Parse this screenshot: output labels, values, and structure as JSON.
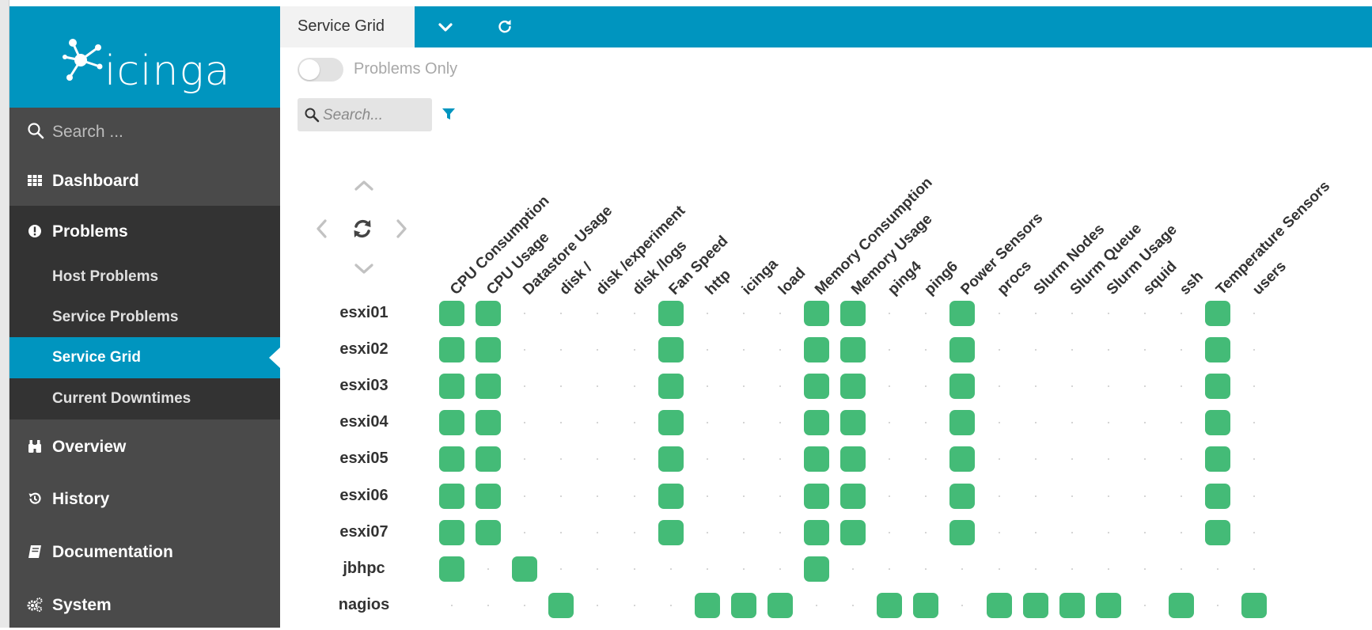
{
  "app": {
    "logo_text": "icinga"
  },
  "sidebar": {
    "search_placeholder": "Search ...",
    "items": [
      {
        "label": "Dashboard"
      },
      {
        "label": "Problems"
      },
      {
        "label": "Overview"
      },
      {
        "label": "History"
      },
      {
        "label": "Documentation"
      },
      {
        "label": "System"
      }
    ],
    "problems_sub": [
      {
        "label": "Host Problems"
      },
      {
        "label": "Service Problems"
      },
      {
        "label": "Service Grid",
        "active": true
      },
      {
        "label": "Current Downtimes"
      }
    ]
  },
  "tab": {
    "title": "Service Grid"
  },
  "toggle": {
    "label": "Problems Only",
    "on": false
  },
  "grid_search": {
    "placeholder": "Search..."
  },
  "colors": {
    "brand": "#0095bf",
    "ok": "#44bb77",
    "sidebar": "#4a4a4a",
    "sidebar_dark": "#333333"
  },
  "grid": {
    "services": [
      "CPU Consumption",
      "CPU Usage",
      "Datastore Usage",
      "disk /",
      "disk /experiment",
      "disk /logs",
      "Fan Speed",
      "http",
      "icinga",
      "load",
      "Memory Consumption",
      "Memory Usage",
      "ping4",
      "ping6",
      "Power Sensors",
      "procs",
      "Slurm Nodes",
      "Slurm Queue",
      "Slurm Usage",
      "squid",
      "ssh",
      "Temperature Sensors",
      "users"
    ],
    "hosts": [
      {
        "name": "esxi01",
        "ok": [
          0,
          1,
          6,
          10,
          11,
          14,
          21
        ]
      },
      {
        "name": "esxi02",
        "ok": [
          0,
          1,
          6,
          10,
          11,
          14,
          21
        ]
      },
      {
        "name": "esxi03",
        "ok": [
          0,
          1,
          6,
          10,
          11,
          14,
          21
        ]
      },
      {
        "name": "esxi04",
        "ok": [
          0,
          1,
          6,
          10,
          11,
          14,
          21
        ]
      },
      {
        "name": "esxi05",
        "ok": [
          0,
          1,
          6,
          10,
          11,
          14,
          21
        ]
      },
      {
        "name": "esxi06",
        "ok": [
          0,
          1,
          6,
          10,
          11,
          14,
          21
        ]
      },
      {
        "name": "esxi07",
        "ok": [
          0,
          1,
          6,
          10,
          11,
          14,
          21
        ]
      },
      {
        "name": "jbhpc",
        "ok": [
          0,
          2,
          10
        ]
      },
      {
        "name": "nagios",
        "ok": [
          3,
          7,
          8,
          9,
          12,
          13,
          15,
          16,
          17,
          18,
          20,
          22
        ]
      }
    ]
  }
}
